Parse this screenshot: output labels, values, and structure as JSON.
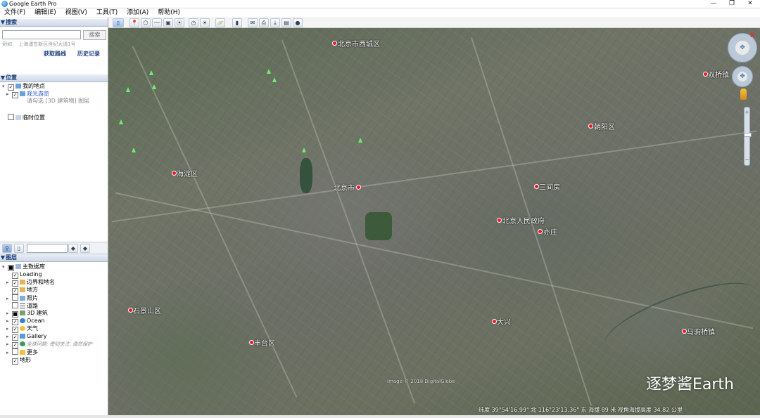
{
  "window": {
    "title": "Google Earth Pro"
  },
  "menu": [
    "文件(F)",
    "编辑(E)",
    "视图(V)",
    "工具(T)",
    "添加(A)",
    "帮助(H)"
  ],
  "search": {
    "header": "搜索",
    "placeholder": "",
    "button_label": "搜索",
    "example": "例如： 上海浦东新区世纪大道1号",
    "directions_link": "获取路线",
    "history_link": "历史记录"
  },
  "places": {
    "header": "位置",
    "my_places": "我的地点",
    "tour_item": "观光游览",
    "tour_hint": "请勾选 [3D 建筑物] 图层",
    "temp_places": "临时位置"
  },
  "layers": {
    "header": "图层",
    "primary_db": "主数据库",
    "items": [
      {
        "label": "Loading",
        "checked": true
      },
      {
        "label": "边界和地名",
        "checked": true
      },
      {
        "label": "地方",
        "checked": true
      },
      {
        "label": "照片",
        "checked": false
      },
      {
        "label": "道路",
        "checked": false
      },
      {
        "label": "3D 建筑",
        "checked": false
      },
      {
        "label": "Ocean",
        "checked": true
      },
      {
        "label": "天气",
        "checked": true
      },
      {
        "label": "Gallery",
        "checked": true
      },
      {
        "label": "全球问题: 密切关注. 请您保护",
        "checked": true
      },
      {
        "label": "更多",
        "checked": false
      },
      {
        "label": "地形",
        "checked": true
      }
    ]
  },
  "map": {
    "labels": [
      {
        "text": "北京市西城区",
        "name": "map-label-xicheng"
      },
      {
        "text": "海淀区",
        "name": "map-label-haidian"
      },
      {
        "text": "北京市",
        "name": "map-label-beijing"
      },
      {
        "text": "北京人民政府",
        "name": "map-label-gov"
      },
      {
        "text": "石景山区",
        "name": "map-label-shijingshan"
      },
      {
        "text": "丰台区",
        "name": "map-label-fengtai"
      },
      {
        "text": "朝阳区",
        "name": "map-label-chaoyang"
      },
      {
        "text": "双桥镇",
        "name": "map-label-shuangqiao"
      },
      {
        "text": "三间房",
        "name": "map-label-sanjianfang"
      },
      {
        "text": "大兴",
        "name": "map-label-daxing"
      },
      {
        "text": "马驹桥镇",
        "name": "map-label-majuqiao"
      },
      {
        "text": "亦庄",
        "name": "map-label-yizhuang"
      }
    ],
    "status": "纬度 39°54'16.99\" 北 116°23'13.36\" 东 海拔 89 米   视角海拔高度 34.82 公里",
    "image_credit": "Image © 2018 DigitalGlobe",
    "watermark": "逐梦酱Earth"
  },
  "colors": {
    "accent": "#1a3d7c",
    "link": "#1f4fd1",
    "pin": "#e8152a"
  }
}
